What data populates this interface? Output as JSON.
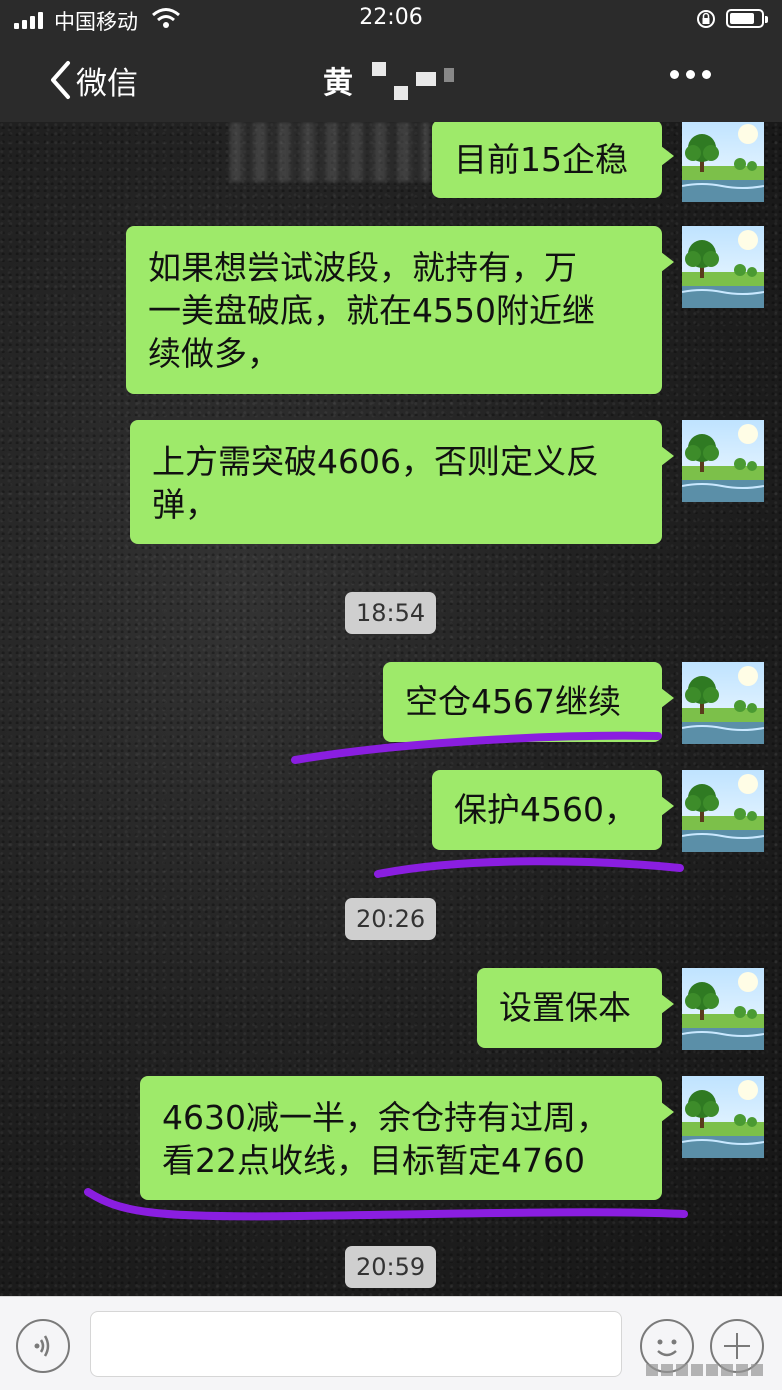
{
  "status_bar": {
    "carrier": "中国移动",
    "time": "22:06"
  },
  "nav": {
    "back_label": "微信",
    "title": "黄"
  },
  "messages": [
    {
      "type": "outgoing",
      "text": "目前15企稳"
    },
    {
      "type": "outgoing",
      "text": "如果想尝试波段，就持有，万一美盘破底，就在4550附近继续做多，",
      "lines": [
        "如果想尝试波段，就持有，万",
        "一美盘破底，就在4550附近继",
        "续做多，"
      ]
    },
    {
      "type": "outgoing",
      "text": "上方需突破4606，否则定义反弹，",
      "lines": [
        "上方需突破4606，否则定义反",
        "弹，"
      ]
    },
    {
      "type": "time",
      "text": "18:54"
    },
    {
      "type": "outgoing",
      "text": "空仓4567继续"
    },
    {
      "type": "outgoing",
      "text": "保护4560，"
    },
    {
      "type": "time",
      "text": "20:26"
    },
    {
      "type": "outgoing",
      "text": "设置保本"
    },
    {
      "type": "outgoing",
      "text": "4630减一半，余仓持有过周，看22点收线，目标暂定4760",
      "lines": [
        "4630减一半，余仓持有过周，",
        "看22点收线，目标暂定4760"
      ]
    },
    {
      "type": "time",
      "text": "20:59"
    }
  ],
  "colors": {
    "bubble": "#9eea6a",
    "annotation": "#8a1ee0",
    "bar": "#2b2b2b"
  },
  "icons": {
    "back": "chevron-left-icon",
    "more": "ellipsis-icon",
    "voice": "voice-icon",
    "emoji": "emoji-icon",
    "plus": "plus-icon"
  }
}
